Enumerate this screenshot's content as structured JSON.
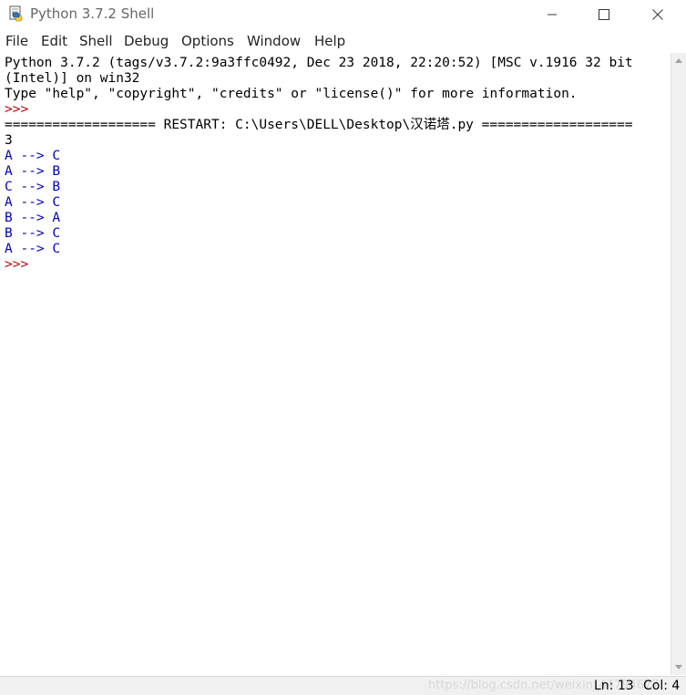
{
  "window": {
    "title": "Python 3.7.2 Shell",
    "icon": "python-idle-icon",
    "controls": [
      "minimize-icon",
      "maximize-icon",
      "close-icon"
    ]
  },
  "menu": [
    "File",
    "Edit",
    "Shell",
    "Debug",
    "Options",
    "Window",
    "Help"
  ],
  "shell": {
    "banner_line1": "Python 3.7.2 (tags/v3.7.2:9a3ffc0492, Dec 23 2018, 22:20:52) [MSC v.1916 32 bit",
    "banner_line2": "(Intel)] on win32",
    "banner_line3": "Type \"help\", \"copyright\", \"credits\" or \"license()\" for more information.",
    "prompt": ">>>",
    "restart_line": "=================== RESTART: C:\\Users\\DELL\\Desktop\\汉诺塔.py ===================",
    "input_echo": "3",
    "output_lines": [
      "A --> C",
      "A --> B",
      "C --> B",
      "A --> C",
      "B --> A",
      "B --> C",
      "A --> C"
    ]
  },
  "status": {
    "watermark": "https://blog.csdn.net/weixin_44794677",
    "line": "Ln: 13",
    "col": "Col: 4"
  },
  "colors": {
    "prompt": "#c00000",
    "stdout": "#0000c0",
    "text": "#000000"
  }
}
